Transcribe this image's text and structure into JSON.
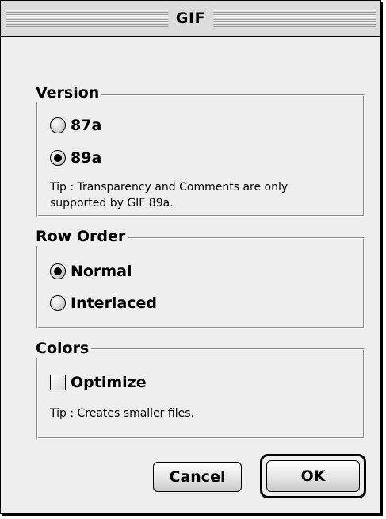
{
  "window": {
    "title": "GIF"
  },
  "version": {
    "label": "Version",
    "options": [
      {
        "label": "87a",
        "selected": false
      },
      {
        "label": "89a",
        "selected": true
      }
    ],
    "tip": "Tip : Transparency and Comments are only supported by GIF 89a."
  },
  "row_order": {
    "label": "Row Order",
    "options": [
      {
        "label": "Normal",
        "selected": true
      },
      {
        "label": "Interlaced",
        "selected": false
      }
    ]
  },
  "colors": {
    "label": "Colors",
    "optimize": {
      "label": "Optimize",
      "checked": false
    },
    "tip": "Tip : Creates smaller files."
  },
  "buttons": {
    "cancel": "Cancel",
    "ok": "OK"
  }
}
